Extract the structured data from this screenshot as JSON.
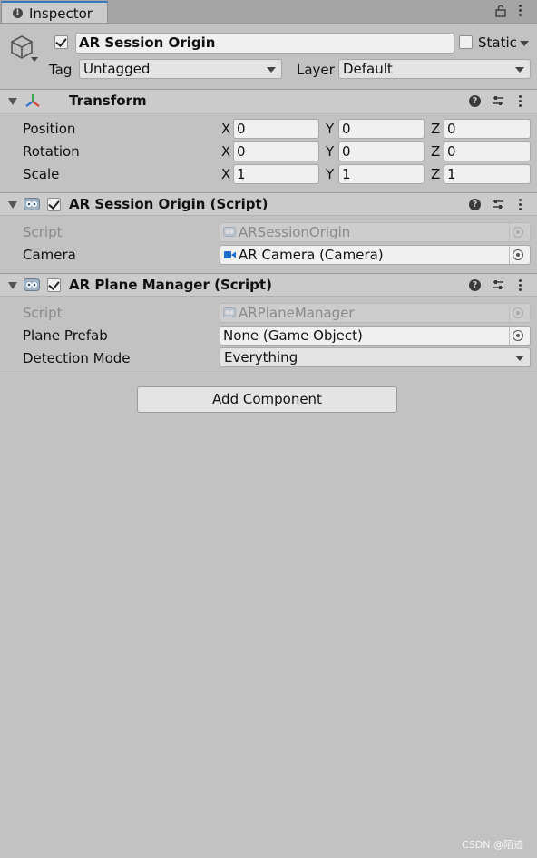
{
  "window": {
    "tab_label": "Inspector",
    "tab_icon": "info-icon",
    "lock_icon": "lock-icon",
    "menu_icon": "kebab-menu-icon"
  },
  "object": {
    "icon": "gameobject-cube-icon",
    "active": true,
    "name": "AR Session Origin",
    "static_label": "Static",
    "static_checked": false,
    "tag_label": "Tag",
    "tag_value": "Untagged",
    "layer_label": "Layer",
    "layer_value": "Default"
  },
  "transform": {
    "title": "Transform",
    "rows": [
      {
        "label": "Position",
        "x": "0",
        "y": "0",
        "z": "0"
      },
      {
        "label": "Rotation",
        "x": "0",
        "y": "0",
        "z": "0"
      },
      {
        "label": "Scale",
        "x": "1",
        "y": "1",
        "z": "1"
      }
    ],
    "axis_x": "X",
    "axis_y": "Y",
    "axis_z": "Z"
  },
  "session_origin": {
    "title": "AR Session Origin (Script)",
    "enabled": true,
    "script_label": "Script",
    "script_value": "ARSessionOrigin",
    "camera_label": "Camera",
    "camera_value": "AR Camera (Camera)"
  },
  "plane_manager": {
    "title": "AR Plane Manager (Script)",
    "enabled": true,
    "script_label": "Script",
    "script_value": "ARPlaneManager",
    "prefab_label": "Plane Prefab",
    "prefab_value": "None (Game Object)",
    "mode_label": "Detection Mode",
    "mode_value": "Everything"
  },
  "add_component_label": "Add Component",
  "watermark": "CSDN @陌迹",
  "colors": {
    "background": "#c2c2c2",
    "header": "#cbcbcb",
    "tab_accent": "#3a79bb",
    "camera_icon": "#1f6fd1"
  }
}
